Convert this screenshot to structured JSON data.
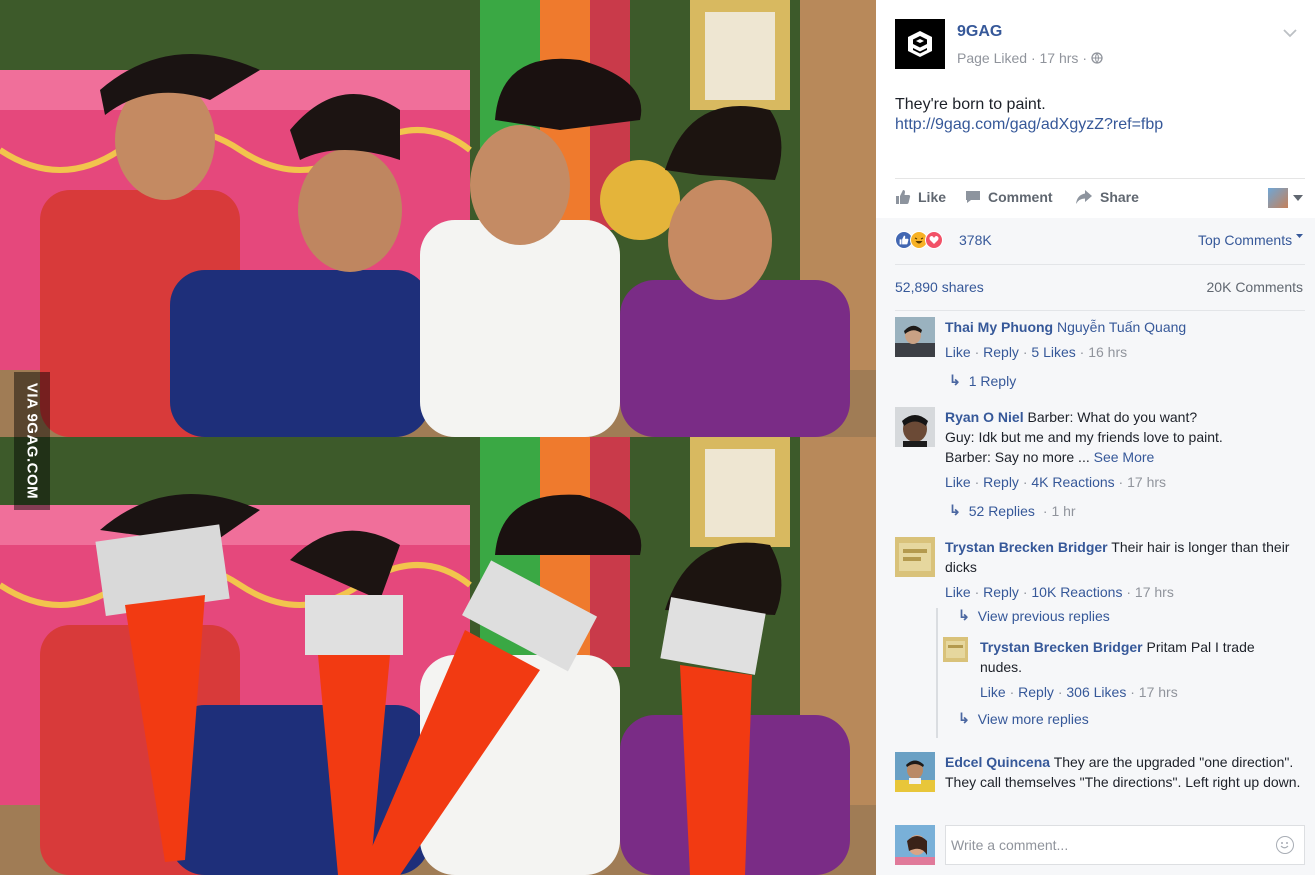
{
  "photo": {
    "watermark": "VIA 9GAG.COM"
  },
  "post": {
    "page_name": "9GAG",
    "page_status": "Page Liked",
    "time": "17 hrs",
    "caption_text": "They're born to paint.",
    "caption_link": "http://9gag.com/gag/adXgyzZ?ref=fbp"
  },
  "actions": {
    "like": "Like",
    "comment": "Comment",
    "share": "Share"
  },
  "stats": {
    "reactions_count": "378K",
    "top_comments": "Top Comments",
    "shares": "52,890 shares",
    "comments": "20K Comments"
  },
  "comments": [
    {
      "author": "Thai My Phuong",
      "tag": "Nguyễn Tuấn Quang",
      "text": "",
      "like": "Like",
      "reply": "Reply",
      "reactions": "5 Likes",
      "time": "16 hrs",
      "replies_link": "1 Reply",
      "replies_time": ""
    },
    {
      "author": "Ryan O Niel",
      "text_lines": [
        "Barber: What do you want?",
        "Guy: Idk but me and my friends love to paint.",
        "Barber: Say no more ..."
      ],
      "see_more": "See More",
      "like": "Like",
      "reply": "Reply",
      "reactions": "4K Reactions",
      "time": "17 hrs",
      "replies_link": "52 Replies",
      "replies_time": "1 hr"
    },
    {
      "author": "Trystan Brecken Bridger",
      "text": "Their hair is longer than their dicks",
      "like": "Like",
      "reply": "Reply",
      "reactions": "10K Reactions",
      "time": "17 hrs",
      "view_previous": "View previous replies",
      "sub": {
        "author": "Trystan Brecken Bridger",
        "text": "Pritam Pal I trade nudes.",
        "like": "Like",
        "reply": "Reply",
        "reactions": "306 Likes",
        "time": "17 hrs"
      },
      "view_more": "View more replies"
    },
    {
      "author": "Edcel Quincena",
      "text": "They are the upgraded \"one direction\". They call themselves \"The directions\". Left right up down."
    }
  ],
  "write_comment": {
    "placeholder": "Write a comment..."
  },
  "colors": {
    "link": "#365899",
    "meta": "#90949c",
    "action": "#606770",
    "like_blue": "#4267b2",
    "love_red": "#f25268",
    "haha_yellow": "#f7b125"
  }
}
